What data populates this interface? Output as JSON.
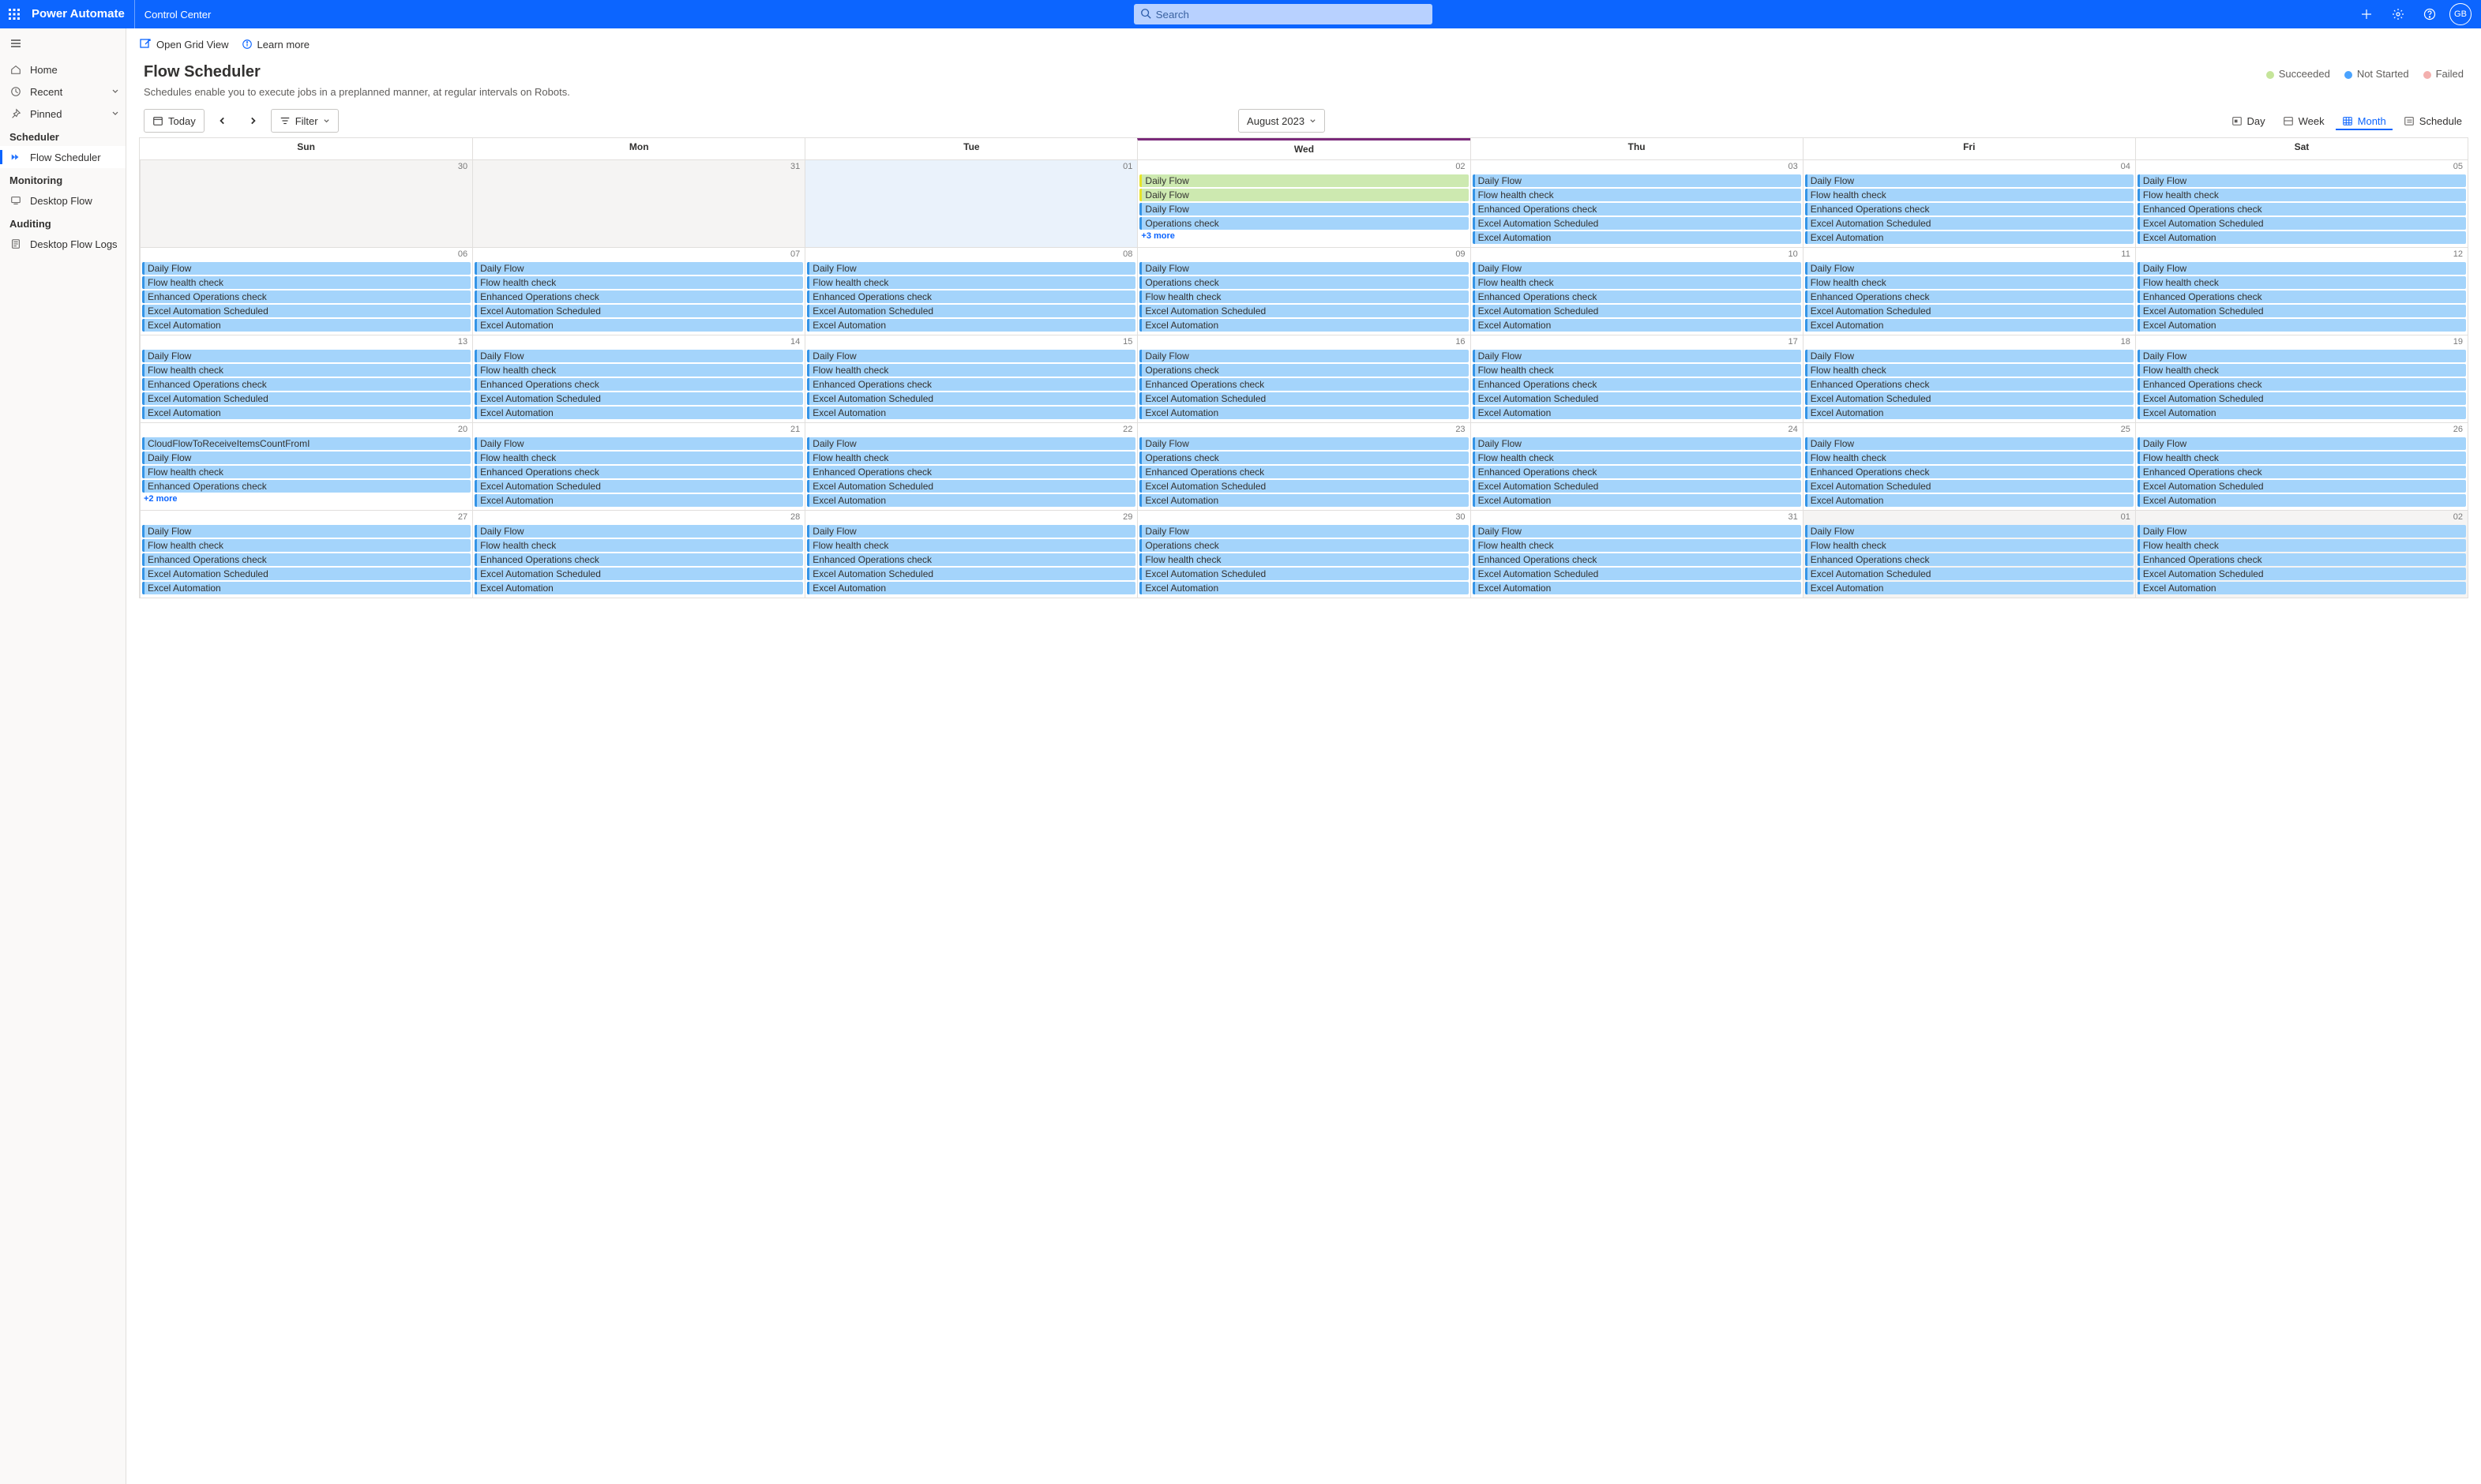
{
  "top": {
    "brand": "Power Automate",
    "sub": "Control Center",
    "search_placeholder": "Search",
    "avatar": "GB"
  },
  "sidebar": {
    "home": "Home",
    "recent": "Recent",
    "pinned": "Pinned",
    "scheduler_heading": "Scheduler",
    "flow_scheduler": "Flow Scheduler",
    "monitoring_heading": "Monitoring",
    "desktop_flow": "Desktop Flow",
    "auditing_heading": "Auditing",
    "desktop_flow_logs": "Desktop Flow Logs"
  },
  "cmd": {
    "open_grid": "Open Grid View",
    "learn": "Learn more"
  },
  "page": {
    "title": "Flow Scheduler",
    "desc": "Schedules enable you to execute jobs in a preplanned manner, at regular intervals on Robots."
  },
  "legend": {
    "succeeded": "Succeeded",
    "not_started": "Not Started",
    "failed": "Failed"
  },
  "toolbar": {
    "today": "Today",
    "filter": "Filter",
    "month_label": "August 2023",
    "views": {
      "day": "Day",
      "week": "Week",
      "month": "Month",
      "schedule": "Schedule"
    }
  },
  "weekdays": [
    "Sun",
    "Mon",
    "Tue",
    "Wed",
    "Thu",
    "Fri",
    "Sat"
  ],
  "event_labels": {
    "daily": "Daily Flow",
    "health": "Flow health check",
    "ops": "Operations check",
    "enh": "Enhanced Operations check",
    "sched": "Excel Automation Scheduled",
    "excel": "Excel Automation",
    "cloud": "CloudFlowToReceiveItemsCountFromI"
  },
  "more3": "+3 more",
  "more2": "+2 more",
  "calendar": [
    [
      {
        "n": "30",
        "out": true,
        "events": []
      },
      {
        "n": "31",
        "out": true,
        "events": []
      },
      {
        "n": "01",
        "events": [],
        "today": true
      },
      {
        "n": "02",
        "wed": true,
        "events": [
          {
            "k": "daily",
            "run": true
          },
          {
            "k": "daily",
            "run": true
          },
          {
            "k": "daily"
          },
          {
            "k": "ops"
          }
        ],
        "more": "more3"
      },
      {
        "n": "03",
        "events": [
          {
            "k": "daily"
          },
          {
            "k": "health"
          },
          {
            "k": "enh"
          },
          {
            "k": "sched"
          },
          {
            "k": "excel"
          }
        ]
      },
      {
        "n": "04",
        "events": [
          {
            "k": "daily"
          },
          {
            "k": "health"
          },
          {
            "k": "enh"
          },
          {
            "k": "sched"
          },
          {
            "k": "excel"
          }
        ]
      },
      {
        "n": "05",
        "events": [
          {
            "k": "daily"
          },
          {
            "k": "health"
          },
          {
            "k": "enh"
          },
          {
            "k": "sched"
          },
          {
            "k": "excel"
          }
        ]
      }
    ],
    [
      {
        "n": "06",
        "events": [
          {
            "k": "daily"
          },
          {
            "k": "health"
          },
          {
            "k": "enh"
          },
          {
            "k": "sched"
          },
          {
            "k": "excel"
          }
        ]
      },
      {
        "n": "07",
        "events": [
          {
            "k": "daily"
          },
          {
            "k": "health"
          },
          {
            "k": "enh"
          },
          {
            "k": "sched"
          },
          {
            "k": "excel"
          }
        ]
      },
      {
        "n": "08",
        "events": [
          {
            "k": "daily"
          },
          {
            "k": "health"
          },
          {
            "k": "enh"
          },
          {
            "k": "sched"
          },
          {
            "k": "excel"
          }
        ]
      },
      {
        "n": "09",
        "wed": true,
        "events": [
          {
            "k": "daily"
          },
          {
            "k": "ops"
          },
          {
            "k": "health"
          },
          {
            "k": "sched"
          },
          {
            "k": "excel"
          }
        ]
      },
      {
        "n": "10",
        "events": [
          {
            "k": "daily"
          },
          {
            "k": "health"
          },
          {
            "k": "enh"
          },
          {
            "k": "sched"
          },
          {
            "k": "excel"
          }
        ]
      },
      {
        "n": "11",
        "events": [
          {
            "k": "daily"
          },
          {
            "k": "health"
          },
          {
            "k": "enh"
          },
          {
            "k": "sched"
          },
          {
            "k": "excel"
          }
        ]
      },
      {
        "n": "12",
        "events": [
          {
            "k": "daily"
          },
          {
            "k": "health"
          },
          {
            "k": "enh"
          },
          {
            "k": "sched"
          },
          {
            "k": "excel"
          }
        ]
      }
    ],
    [
      {
        "n": "13",
        "events": [
          {
            "k": "daily"
          },
          {
            "k": "health"
          },
          {
            "k": "enh"
          },
          {
            "k": "sched"
          },
          {
            "k": "excel"
          }
        ]
      },
      {
        "n": "14",
        "events": [
          {
            "k": "daily"
          },
          {
            "k": "health"
          },
          {
            "k": "enh"
          },
          {
            "k": "sched"
          },
          {
            "k": "excel"
          }
        ]
      },
      {
        "n": "15",
        "events": [
          {
            "k": "daily"
          },
          {
            "k": "health"
          },
          {
            "k": "enh"
          },
          {
            "k": "sched"
          },
          {
            "k": "excel"
          }
        ]
      },
      {
        "n": "16",
        "wed": true,
        "events": [
          {
            "k": "daily"
          },
          {
            "k": "ops"
          },
          {
            "k": "enh"
          },
          {
            "k": "sched"
          },
          {
            "k": "excel"
          }
        ]
      },
      {
        "n": "17",
        "events": [
          {
            "k": "daily"
          },
          {
            "k": "health"
          },
          {
            "k": "enh"
          },
          {
            "k": "sched"
          },
          {
            "k": "excel"
          }
        ]
      },
      {
        "n": "18",
        "events": [
          {
            "k": "daily"
          },
          {
            "k": "health"
          },
          {
            "k": "enh"
          },
          {
            "k": "sched"
          },
          {
            "k": "excel"
          }
        ]
      },
      {
        "n": "19",
        "events": [
          {
            "k": "daily"
          },
          {
            "k": "health"
          },
          {
            "k": "enh"
          },
          {
            "k": "sched"
          },
          {
            "k": "excel"
          }
        ]
      }
    ],
    [
      {
        "n": "20",
        "events": [
          {
            "k": "cloud"
          },
          {
            "k": "daily"
          },
          {
            "k": "health"
          },
          {
            "k": "enh"
          }
        ],
        "more": "more2"
      },
      {
        "n": "21",
        "events": [
          {
            "k": "daily"
          },
          {
            "k": "health"
          },
          {
            "k": "enh"
          },
          {
            "k": "sched"
          },
          {
            "k": "excel"
          }
        ]
      },
      {
        "n": "22",
        "events": [
          {
            "k": "daily"
          },
          {
            "k": "health"
          },
          {
            "k": "enh"
          },
          {
            "k": "sched"
          },
          {
            "k": "excel"
          }
        ]
      },
      {
        "n": "23",
        "wed": true,
        "events": [
          {
            "k": "daily"
          },
          {
            "k": "ops"
          },
          {
            "k": "enh"
          },
          {
            "k": "sched"
          },
          {
            "k": "excel"
          }
        ]
      },
      {
        "n": "24",
        "events": [
          {
            "k": "daily"
          },
          {
            "k": "health"
          },
          {
            "k": "enh"
          },
          {
            "k": "sched"
          },
          {
            "k": "excel"
          }
        ]
      },
      {
        "n": "25",
        "events": [
          {
            "k": "daily"
          },
          {
            "k": "health"
          },
          {
            "k": "enh"
          },
          {
            "k": "sched"
          },
          {
            "k": "excel"
          }
        ]
      },
      {
        "n": "26",
        "events": [
          {
            "k": "daily"
          },
          {
            "k": "health"
          },
          {
            "k": "enh"
          },
          {
            "k": "sched"
          },
          {
            "k": "excel"
          }
        ]
      }
    ],
    [
      {
        "n": "27",
        "events": [
          {
            "k": "daily"
          },
          {
            "k": "health"
          },
          {
            "k": "enh"
          },
          {
            "k": "sched"
          },
          {
            "k": "excel"
          }
        ]
      },
      {
        "n": "28",
        "events": [
          {
            "k": "daily"
          },
          {
            "k": "health"
          },
          {
            "k": "enh"
          },
          {
            "k": "sched"
          },
          {
            "k": "excel"
          }
        ]
      },
      {
        "n": "29",
        "events": [
          {
            "k": "daily"
          },
          {
            "k": "health"
          },
          {
            "k": "enh"
          },
          {
            "k": "sched"
          },
          {
            "k": "excel"
          }
        ]
      },
      {
        "n": "30",
        "wed": true,
        "events": [
          {
            "k": "daily"
          },
          {
            "k": "ops"
          },
          {
            "k": "health"
          },
          {
            "k": "sched"
          },
          {
            "k": "excel"
          }
        ]
      },
      {
        "n": "31",
        "events": [
          {
            "k": "daily"
          },
          {
            "k": "health"
          },
          {
            "k": "enh"
          },
          {
            "k": "sched"
          },
          {
            "k": "excel"
          }
        ]
      },
      {
        "n": "01",
        "out": true,
        "events": [
          {
            "k": "daily"
          },
          {
            "k": "health"
          },
          {
            "k": "enh"
          },
          {
            "k": "sched"
          },
          {
            "k": "excel"
          }
        ]
      },
      {
        "n": "02",
        "out": true,
        "events": [
          {
            "k": "daily"
          },
          {
            "k": "health"
          },
          {
            "k": "enh"
          },
          {
            "k": "sched"
          },
          {
            "k": "excel"
          }
        ]
      }
    ]
  ]
}
